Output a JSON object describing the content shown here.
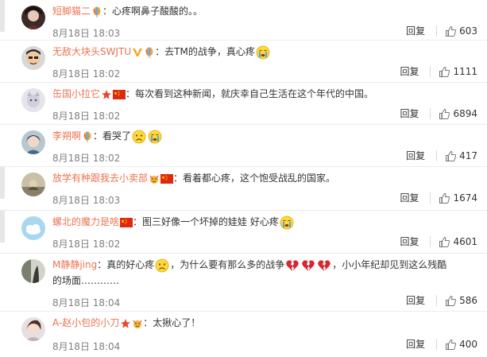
{
  "comments": [
    {
      "username": "短脚猫二",
      "content": "：心疼啊鼻子酸酸的。。",
      "date": "8月18日 18:03",
      "reply_label": "回复",
      "likes": "603"
    },
    {
      "username": "无敌大块头SWJTU",
      "content": "：去TM的战争，真心疼",
      "date": "8月18日 18:02",
      "reply_label": "回复",
      "likes": "1111"
    },
    {
      "username": "缶国小拉它",
      "content": "：每次看到这种新闻，就庆幸自己生活在这个年代的中国。",
      "date": "8月18日 18:02",
      "reply_label": "回复",
      "likes": "6894"
    },
    {
      "username": "李朔啊",
      "content": "：看哭了",
      "date": "8月18日 18:02",
      "reply_label": "回复",
      "likes": "417"
    },
    {
      "username": "放学有种跟我去小卖部",
      "content": "：看着都心疼，这个饱受战乱的国家。",
      "date": "8月18日 18:03",
      "reply_label": "回复",
      "likes": "1674"
    },
    {
      "username": "螺北的魔力是啥",
      "content": "：图三好像一个坏掉的娃娃 好心疼",
      "date": "8月18日 18:02",
      "reply_label": "回复",
      "likes": "4601"
    },
    {
      "username": "M静静jing",
      "content": "：真的好心疼",
      "content_b": "，为什么要有那么多的战争",
      "content_c": "，小小年纪却见到这么残酷",
      "content_d": "的场面…………",
      "date": "8月18日 18:04",
      "reply_label": "回复",
      "likes": "586"
    },
    {
      "username": "A-赵小包的小刀",
      "content": "：太揪心了！",
      "date": "8月18日 18:04",
      "reply_label": "回复",
      "likes": "400"
    }
  ],
  "colors": {
    "username": "#eb7350",
    "text": "#333333",
    "date": "#808080",
    "divider": "#ececec"
  },
  "icons": {
    "like": "thumbs-up-icon",
    "crying_emoji": "crying-face-icon",
    "sad_emoji": "sad-face-icon",
    "broken_heart": "broken-heart-icon",
    "flag": "china-flag-icon",
    "balloon_badge": "balloon-badge-icon",
    "v_badge": "vip-badge-icon",
    "star_badge": "star-badge-icon"
  }
}
